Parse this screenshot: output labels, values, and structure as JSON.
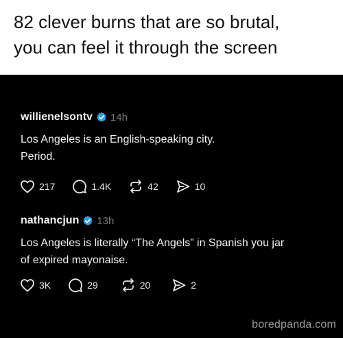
{
  "headline": "82 clever burns that are so brutal,\nyou can feel it through the screen",
  "colors": {
    "background": "#000000",
    "verified": "#2e9de6",
    "time": "#7a7a7a",
    "text": "#f2f2f2"
  },
  "posts": [
    {
      "username": "willienelsontv",
      "time": "14h",
      "text": "Los Angeles is an English-speaking city.\nPeriod.",
      "likes": "217",
      "replies": "1.4K",
      "reposts": "42",
      "shares": "10"
    },
    {
      "username": "nathancjun",
      "time": "13h",
      "text": "Los Angeles is literally “The Angels” in Spanish you jar\nof expired mayonaise.",
      "likes": "3K",
      "replies": "29",
      "reposts": "20",
      "shares": "2"
    }
  ],
  "icons": [
    "heart-icon",
    "comment-icon",
    "repost-icon",
    "share-icon",
    "verified-badge-icon"
  ],
  "watermark": "boredpanda.com"
}
